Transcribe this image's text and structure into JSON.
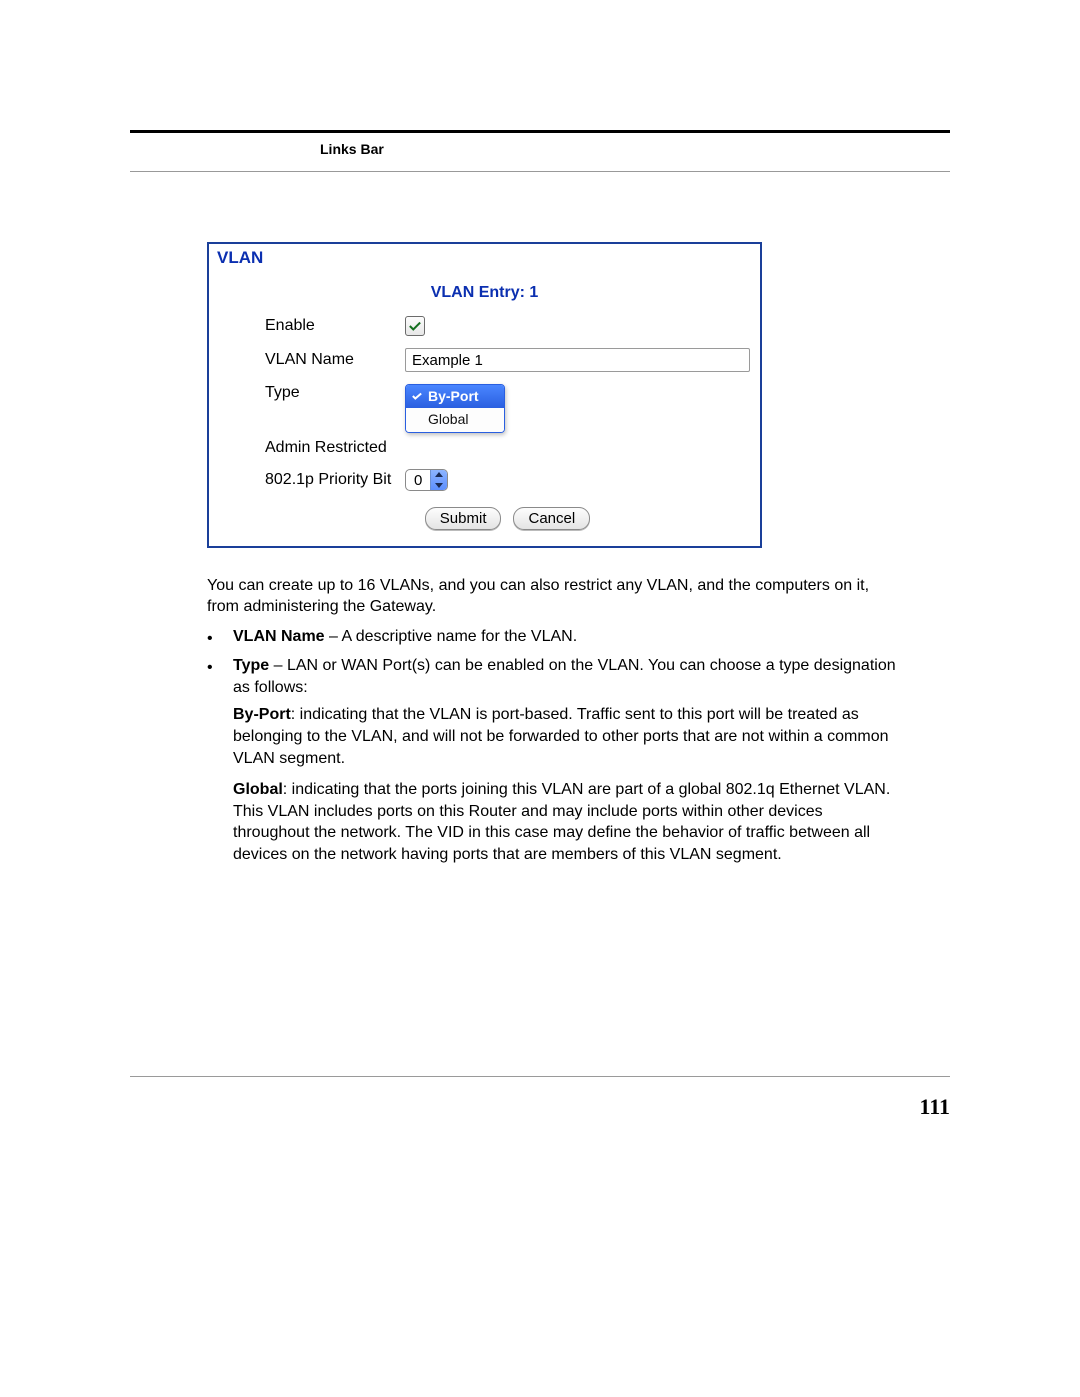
{
  "header": {
    "links_bar": "Links Bar"
  },
  "panel": {
    "title": "VLAN",
    "entry_heading": "VLAN Entry: 1",
    "fields": {
      "enable_label": "Enable",
      "enable_checked": true,
      "vlan_name_label": "VLAN Name",
      "vlan_name_value": "Example 1",
      "type_label": "Type",
      "type_selected": "By-Port",
      "type_option_other": "Global",
      "admin_restricted_label": "Admin Restricted",
      "priority_label": "802.1p Priority Bit",
      "priority_value": "0"
    },
    "buttons": {
      "submit": "Submit",
      "cancel": "Cancel"
    }
  },
  "paragraphs": {
    "intro": "You can create up to 16 VLANs, and you can also restrict any VLAN, and the computers on it, from administering the Gateway.",
    "b1_label": "VLAN Name",
    "b1_text": " – A descriptive name for the VLAN.",
    "b2_label": "Type",
    "b2_text": " – LAN or WAN Port(s) can be enabled on the VLAN. You can choose a type designation as follows:",
    "byport_label": "By-Port",
    "byport_text": ": indicating that the VLAN is port-based. Traffic sent to this port will be treated as belonging to the VLAN, and will not be forwarded to other ports that are not within a common VLAN segment.",
    "global_label": "Global",
    "global_text": ": indicating that the ports joining this VLAN are part of a global 802.1q Ethernet VLAN. This VLAN includes ports on this Router and may include ports within other devices throughout the network. The VID in this case may define the behavior of traffic between all devices on the network having ports that are members of this VLAN segment."
  },
  "page_number": "111"
}
